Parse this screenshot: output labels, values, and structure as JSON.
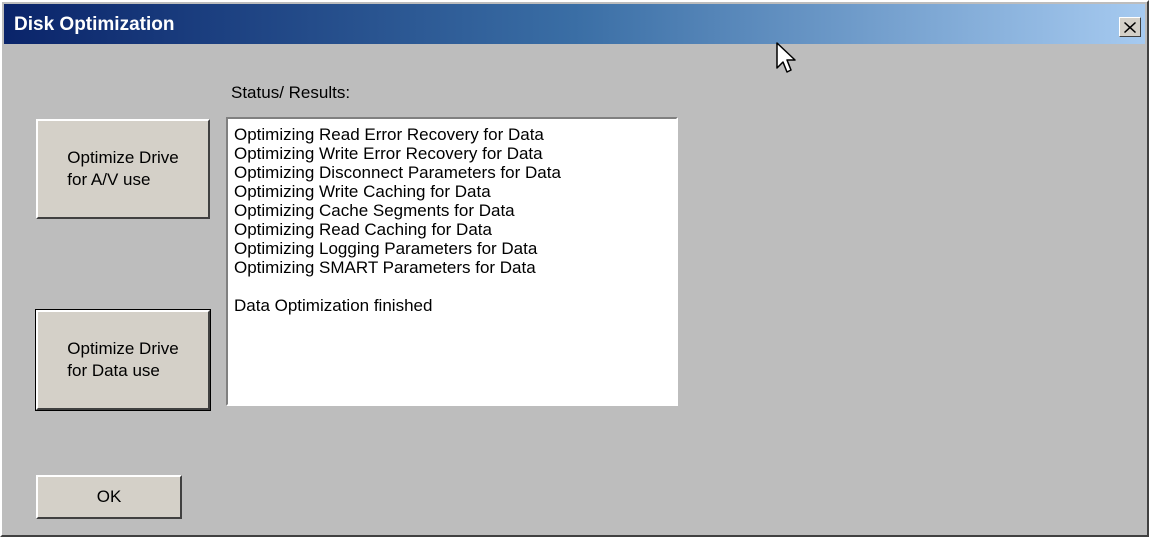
{
  "window": {
    "title": "Disk Optimization",
    "close_label": "X"
  },
  "status_label": "Status/ Results:",
  "buttons": {
    "optimize_av": "Optimize Drive\nfor A/V use",
    "optimize_data": "Optimize Drive\nfor Data use",
    "ok": "OK"
  },
  "results": [
    "Optimizing Read Error Recovery for Data",
    "Optimizing Write Error Recovery for Data",
    "Optimizing Disconnect Parameters for Data",
    "Optimizing Write Caching for Data",
    "Optimizing Cache Segments  for Data",
    "Optimizing Read Caching for Data",
    "Optimizing Logging Parameters for Data",
    "Optimizing SMART Parameters for Data",
    "",
    "Data Optimization finished"
  ],
  "icons": {
    "close": "close-icon",
    "cursor": "mouse-pointer-icon"
  }
}
